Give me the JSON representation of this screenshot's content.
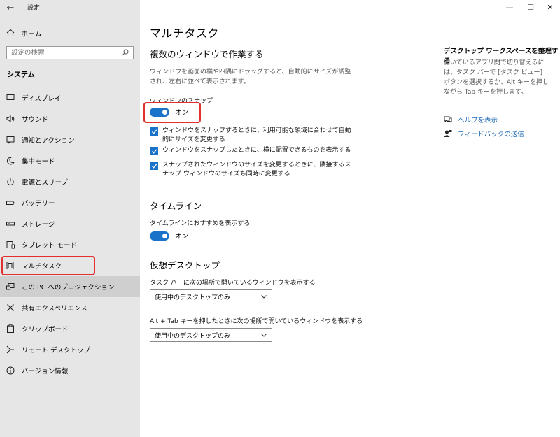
{
  "window": {
    "title": "設定",
    "back_glyph": "←",
    "minimize_glyph": "—",
    "maximize_glyph": "☐",
    "close_glyph": "✕"
  },
  "sidebar": {
    "home_label": "ホーム",
    "search_placeholder": "設定の検索",
    "section_title": "システム",
    "items": [
      {
        "label": "ディスプレイ",
        "icon": "display-icon"
      },
      {
        "label": "サウンド",
        "icon": "sound-icon"
      },
      {
        "label": "通知とアクション",
        "icon": "notification-icon"
      },
      {
        "label": "集中モード",
        "icon": "moon-icon"
      },
      {
        "label": "電源とスリープ",
        "icon": "power-icon"
      },
      {
        "label": "バッテリー",
        "icon": "battery-icon"
      },
      {
        "label": "ストレージ",
        "icon": "storage-icon"
      },
      {
        "label": "タブレット モード",
        "icon": "tablet-icon"
      },
      {
        "label": "マルチタスク",
        "icon": "multitask-icon"
      },
      {
        "label": "この PC へのプロジェクション",
        "icon": "projection-icon"
      },
      {
        "label": "共有エクスペリエンス",
        "icon": "shared-icon"
      },
      {
        "label": "クリップボード",
        "icon": "clipboard-icon"
      },
      {
        "label": "リモート デスクトップ",
        "icon": "remote-icon"
      },
      {
        "label": "バージョン情報",
        "icon": "info-icon"
      }
    ]
  },
  "main": {
    "title": "マルチタスク",
    "snap": {
      "heading": "複数のウィンドウで作業する",
      "description": "ウィンドウを画面の横や四隅にドラッグすると、自動的にサイズが調整され、左右に並べて表示されます。",
      "toggle_label": "ウィンドウのスナップ",
      "toggle_state": "オン",
      "options": [
        "ウィンドウをスナップするときに、利用可能な領域に合わせて自動的にサイズを変更する",
        "ウィンドウをスナップしたときに、横に配置できるものを表示する",
        "スナップされたウィンドウのサイズを変更するときに、隣接するスナップ ウィンドウのサイズも同時に変更する"
      ]
    },
    "timeline": {
      "heading": "タイムライン",
      "toggle_label": "タイムラインにおすすめを表示する",
      "toggle_state": "オン"
    },
    "virtual_desktops": {
      "heading": "仮想デスクトップ",
      "taskbar_label": "タスク バーに次の場所で開いているウィンドウを表示する",
      "taskbar_value": "使用中のデスクトップのみ",
      "alttab_label": "Alt + Tab キーを押したときに次の場所で開いているウィンドウを表示する",
      "alttab_value": "使用中のデスクトップのみ"
    }
  },
  "right": {
    "title": "デスクトップ ワークスペースを整理する",
    "description": "開いているアプリ間で切り替えるには、タスク バーで [タスク ビュー] ボタンを選択するか、Alt キーを押しながら Tab キーを押します。",
    "help_link": "ヘルプを表示",
    "feedback_link": "フィードバックの送信"
  },
  "colors": {
    "accent": "#1a73c9",
    "highlight": "#e03030",
    "sidebar_bg": "#e6e6e6"
  }
}
